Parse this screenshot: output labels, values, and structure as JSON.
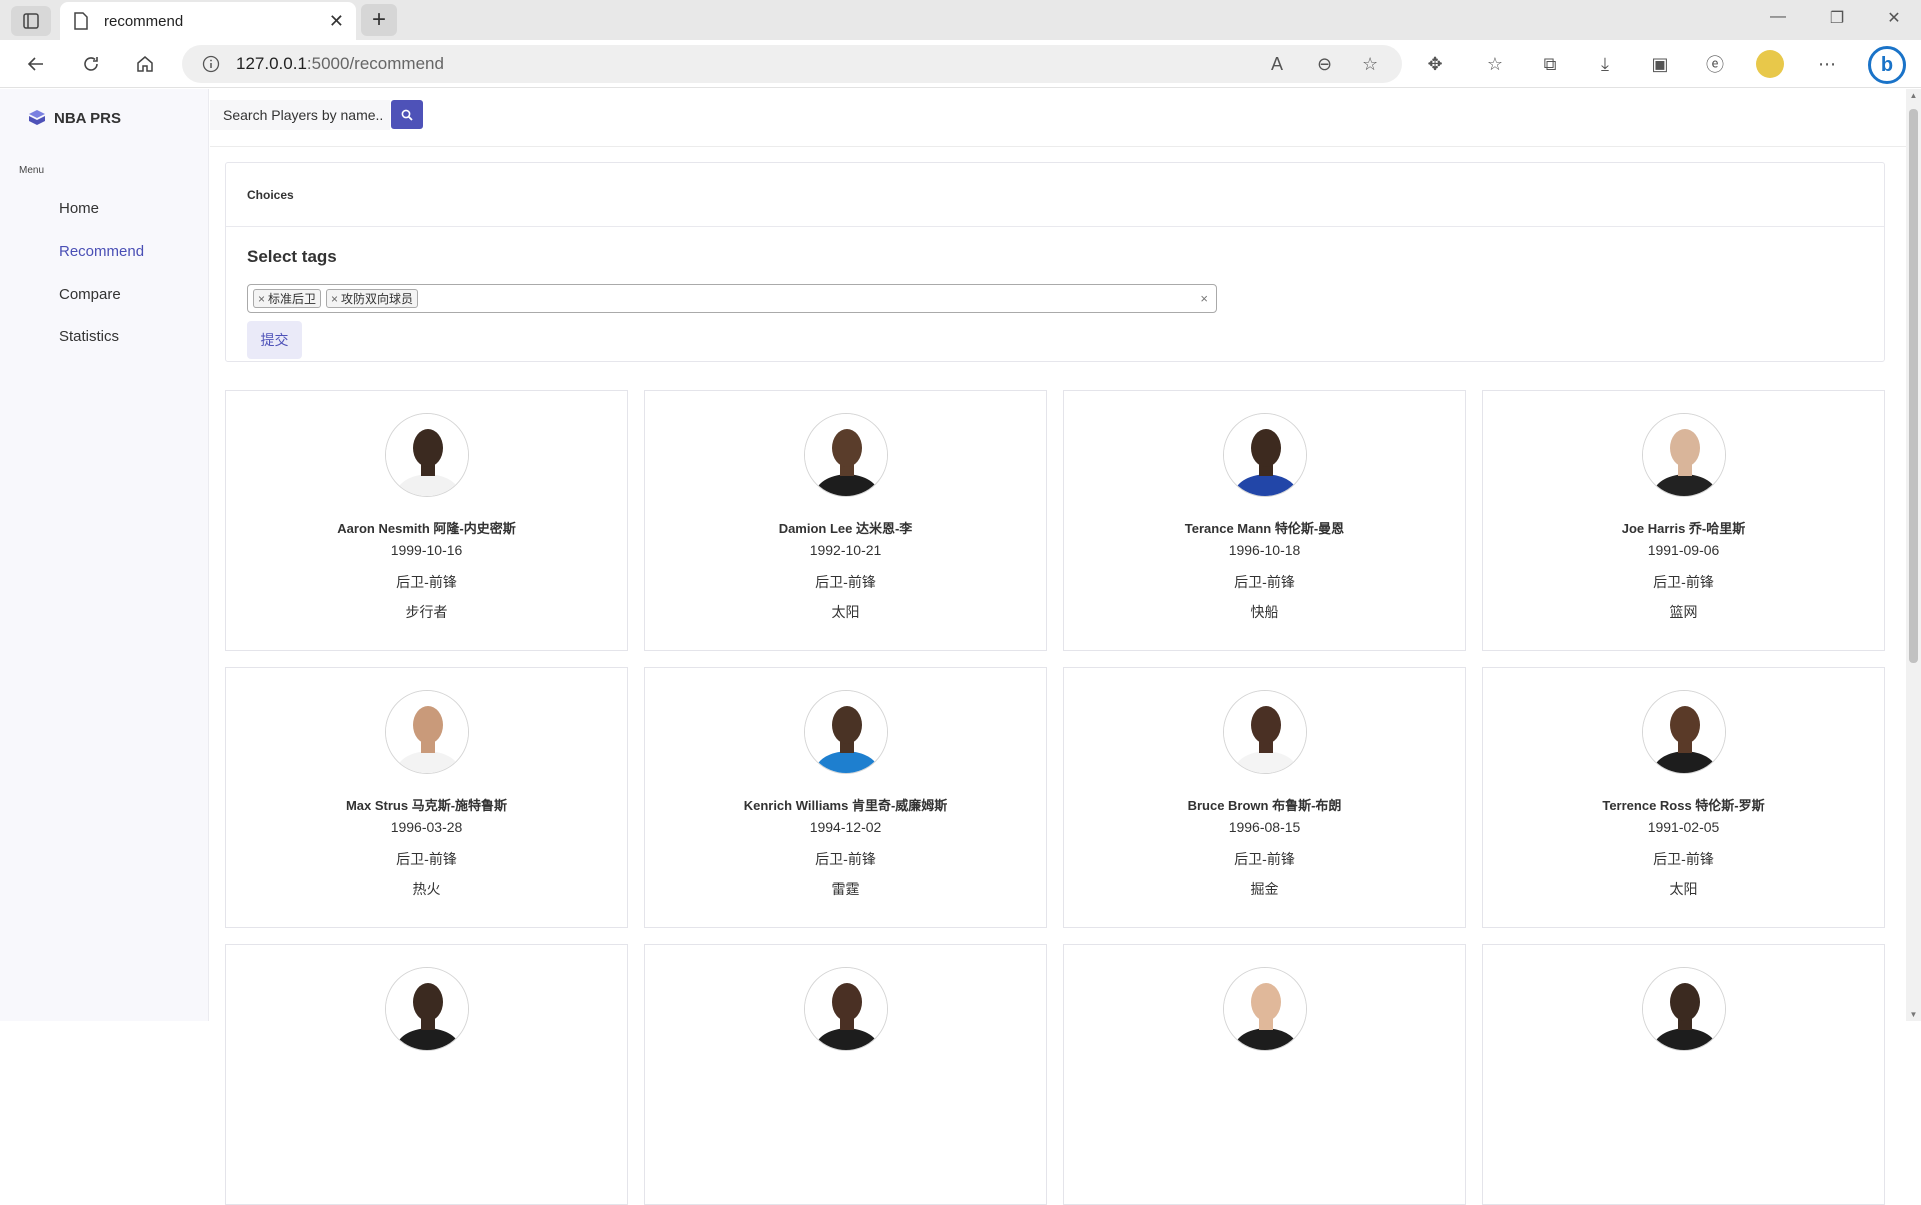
{
  "browser": {
    "tab_title": "recommend",
    "url_host": "127.0.0.1",
    "url_path": ":5000/recommend"
  },
  "sidebar": {
    "brand": "NBA PRS",
    "menu_label": "Menu",
    "items": [
      {
        "label": "Home",
        "active": false
      },
      {
        "label": "Recommend",
        "active": true
      },
      {
        "label": "Compare",
        "active": false
      },
      {
        "label": "Statistics",
        "active": false
      }
    ]
  },
  "search": {
    "placeholder": "Search Players by name.."
  },
  "choices": {
    "header": "Choices",
    "title": "Select tags",
    "tags": [
      "标准后卫",
      "攻防双向球员"
    ],
    "clear": "×",
    "submit_label": "提交"
  },
  "players": [
    {
      "name": "Aaron Nesmith 阿隆-内史密斯",
      "birth": "1999-10-16",
      "position": "后卫-前锋",
      "team": "步行者",
      "jersey": "#f2f2f2",
      "skin": "#3b2a20"
    },
    {
      "name": "Damion Lee 达米恩-李",
      "birth": "1992-10-21",
      "position": "后卫-前锋",
      "team": "太阳",
      "jersey": "#1d1d1d",
      "skin": "#5a3d2b"
    },
    {
      "name": "Terance Mann 特伦斯-曼恩",
      "birth": "1996-10-18",
      "position": "后卫-前锋",
      "team": "快船",
      "jersey": "#2246a8",
      "skin": "#3d2a1f"
    },
    {
      "name": "Joe Harris 乔-哈里斯",
      "birth": "1991-09-06",
      "position": "后卫-前锋",
      "team": "篮网",
      "jersey": "#222222",
      "skin": "#d9b59a"
    },
    {
      "name": "Max Strus 马克斯-施特鲁斯",
      "birth": "1996-03-28",
      "position": "后卫-前锋",
      "team": "热火",
      "jersey": "#f3f3f3",
      "skin": "#c99a7a"
    },
    {
      "name": "Kenrich Williams 肯里奇-威廉姆斯",
      "birth": "1994-12-02",
      "position": "后卫-前锋",
      "team": "雷霆",
      "jersey": "#1e7fcf",
      "skin": "#4a3325"
    },
    {
      "name": "Bruce Brown 布鲁斯-布朗",
      "birth": "1996-08-15",
      "position": "后卫-前锋",
      "team": "掘金",
      "jersey": "#f4f4f4",
      "skin": "#4a3024"
    },
    {
      "name": "Terrence Ross 特伦斯-罗斯",
      "birth": "1991-02-05",
      "position": "后卫-前锋",
      "team": "太阳",
      "jersey": "#1d1d1d",
      "skin": "#5a3a28"
    },
    {
      "name": "",
      "birth": "",
      "position": "",
      "team": "",
      "jersey": "#1d1d1d",
      "skin": "#3b2a20"
    },
    {
      "name": "",
      "birth": "",
      "position": "",
      "team": "",
      "jersey": "#1d1d1d",
      "skin": "#4a3024"
    },
    {
      "name": "",
      "birth": "",
      "position": "",
      "team": "",
      "jersey": "#1d1d1d",
      "skin": "#e0b89a"
    },
    {
      "name": "",
      "birth": "",
      "position": "",
      "team": "",
      "jersey": "#1d1d1d",
      "skin": "#3b2a20"
    }
  ],
  "colors": {
    "accent": "#4e52b8",
    "sidebar_bg": "#f8f8fc"
  }
}
